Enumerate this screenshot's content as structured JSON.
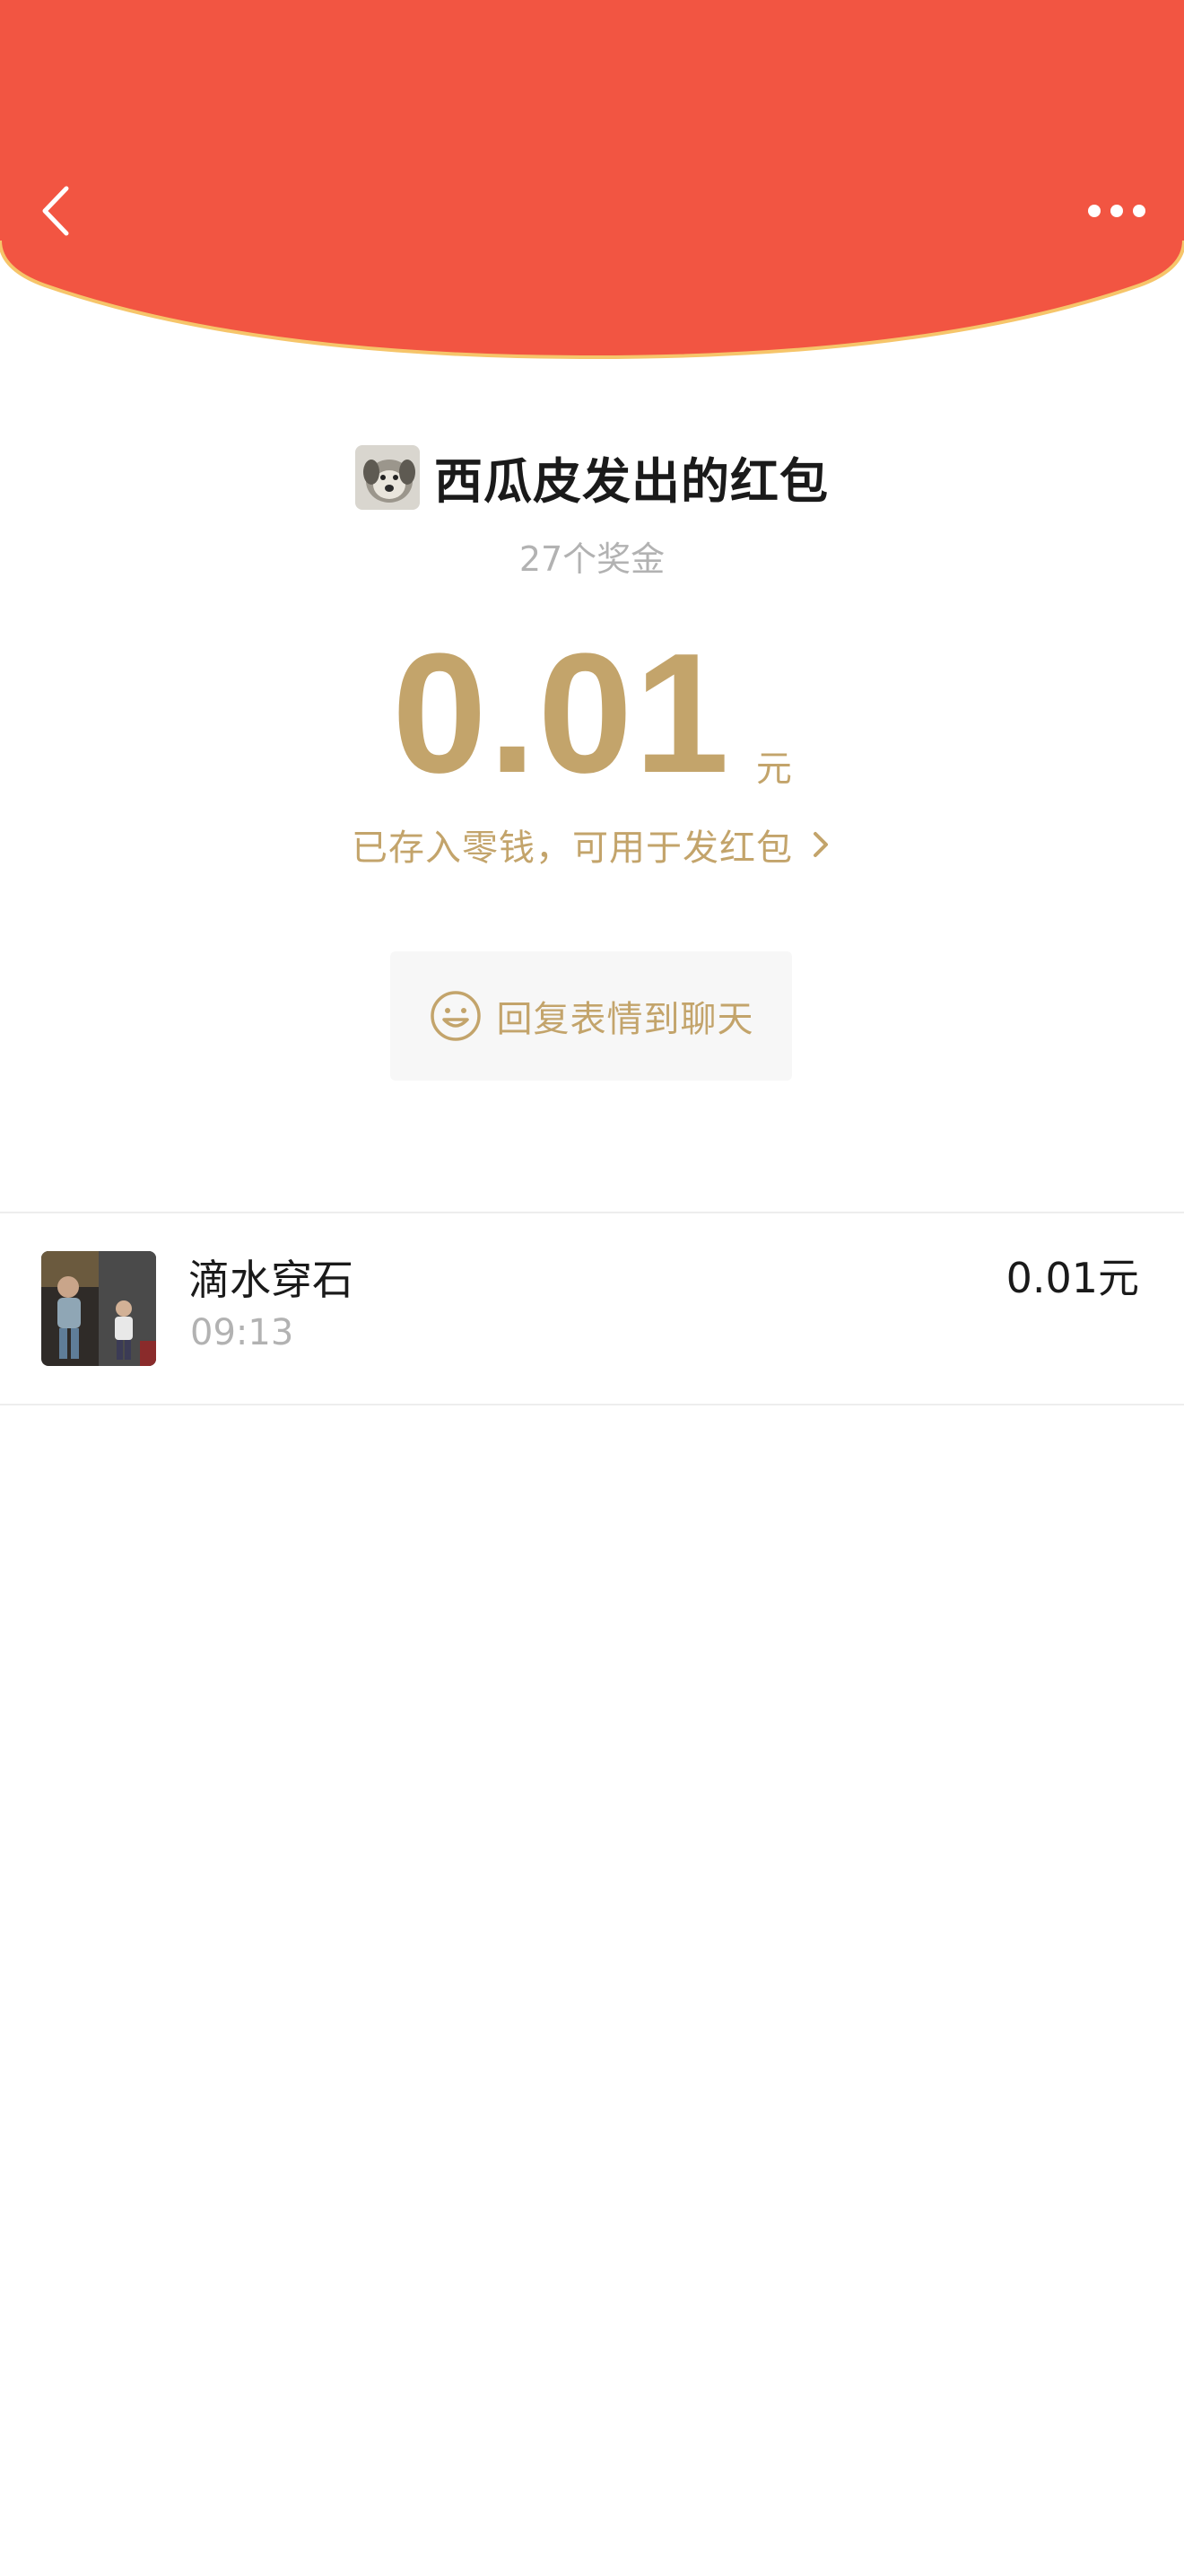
{
  "colors": {
    "header_red": "#f25542",
    "header_edge": "#f6c56a",
    "gold": "#c3a46b",
    "muted_gray": "#b2b2b2",
    "text_dark": "#1a1a1a"
  },
  "header": {
    "back_icon": "chevron-left-icon",
    "more_icon": "more-dots-icon"
  },
  "sender": {
    "avatar_icon": "dog-avatar",
    "title": "西瓜皮发出的红包",
    "subtitle": "27个奖金"
  },
  "amount": {
    "value": "0.01",
    "unit": "元"
  },
  "stored_link": {
    "text": "已存入零钱，可用于发红包",
    "icon": "chevron-right-icon"
  },
  "reply_button": {
    "icon": "smiley-icon",
    "label": "回复表情到聊天"
  },
  "receivers": [
    {
      "name": "滴水穿石",
      "time": "09:13",
      "amount": "0.01元"
    }
  ]
}
